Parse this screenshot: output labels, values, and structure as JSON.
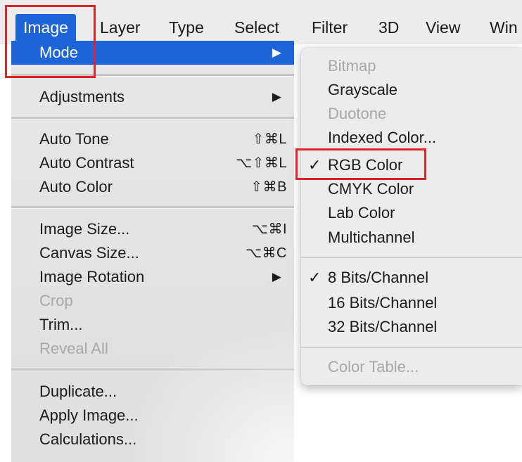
{
  "menubar": {
    "items": [
      {
        "label": "Image",
        "active": true
      },
      {
        "label": "Layer"
      },
      {
        "label": "Type"
      },
      {
        "label": "Select"
      },
      {
        "label": "Filter"
      },
      {
        "label": "3D"
      },
      {
        "label": "View"
      },
      {
        "label": "Win"
      }
    ]
  },
  "image_menu": {
    "items": [
      {
        "label": "Mode",
        "submenu": true,
        "highlighted": true
      },
      {
        "label": "Adjustments",
        "submenu": true
      },
      {
        "label": "Auto Tone",
        "shortcut": "⇧⌘L"
      },
      {
        "label": "Auto Contrast",
        "shortcut": "⌥⇧⌘L"
      },
      {
        "label": "Auto Color",
        "shortcut": "⇧⌘B"
      },
      {
        "label": "Image Size...",
        "shortcut": "⌥⌘I"
      },
      {
        "label": "Canvas Size...",
        "shortcut": "⌥⌘C"
      },
      {
        "label": "Image Rotation",
        "submenu": true
      },
      {
        "label": "Crop",
        "disabled": true
      },
      {
        "label": "Trim..."
      },
      {
        "label": "Reveal All",
        "disabled": true
      },
      {
        "label": "Duplicate..."
      },
      {
        "label": "Apply Image..."
      },
      {
        "label": "Calculations..."
      }
    ],
    "submenu_arrow": "▶"
  },
  "mode_submenu": {
    "check_glyph": "✓",
    "items": [
      {
        "label": "Bitmap",
        "disabled": true
      },
      {
        "label": "Grayscale"
      },
      {
        "label": "Duotone",
        "disabled": true
      },
      {
        "label": "Indexed Color..."
      },
      {
        "label": "RGB Color",
        "checked": true
      },
      {
        "label": "CMYK Color"
      },
      {
        "label": "Lab Color"
      },
      {
        "label": "Multichannel"
      },
      {
        "label": "8 Bits/Channel",
        "checked": true
      },
      {
        "label": "16 Bits/Channel"
      },
      {
        "label": "32 Bits/Channel"
      },
      {
        "label": "Color Table...",
        "disabled": true
      }
    ]
  },
  "colors": {
    "highlight": "#1c64d8",
    "annotation_red": "#e0242c",
    "disabled_text": "#a8a8a8"
  }
}
